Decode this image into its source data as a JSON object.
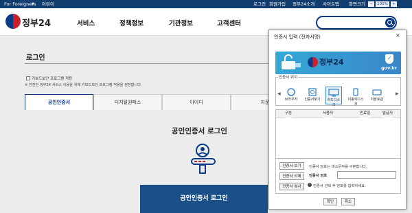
{
  "topbar": {
    "for_foreigners": "For Foreigners",
    "kids": "어린이",
    "login": "로그인",
    "signup": "회원가입",
    "about": "정부24소개",
    "sitemap": "사이트맵",
    "screen_size": "화면크기",
    "zoom_out": "−",
    "zoom_level": "100%",
    "zoom_in": "+"
  },
  "header": {
    "logo": "정부24",
    "nav": [
      "서비스",
      "정책정보",
      "기관정보",
      "고객센터"
    ],
    "search_placeholder": ""
  },
  "login_page": {
    "title": "로그인",
    "keyboard_security_label": "키보드보안 프로그램 적용",
    "keyboard_security_note": "※ 안전한 정부24 서비스 이용을 위해 키보드보안 프로그램 적용을 권장합니다.",
    "tabs": [
      "공인인증서",
      "디지털원패스",
      "아이디",
      "지문"
    ],
    "active_tab": "공인인증서",
    "heading": "공인인증서 로그인",
    "login_button": "공인인증서 로그인"
  },
  "cert_dialog": {
    "title": "인증서 입력 (전자서명)",
    "close": "×",
    "banner_title": "정부24",
    "banner_domain": "gov.kr",
    "location_label": "인증서 위치",
    "locations": [
      "브라우저",
      "인증서찾기",
      "하드디스크",
      "이동식디스크",
      "저장토큰"
    ],
    "selected_location": "하드디스크",
    "columns": [
      "구분",
      "사용자",
      "만료일",
      "발급자"
    ],
    "view_button": "인증서 보기",
    "delete_button": "인증서 삭제",
    "copy_button": "인증서 복사",
    "case_note": "인증서 암호는 대소문자를 구분합니다.",
    "password_label": "인증서 암호",
    "password_value": "",
    "instruction": "인증서 선택 후 암호를 입력하세요.",
    "ok": "확인",
    "cancel": "취소"
  },
  "colors": {
    "topbar": "#123e6f",
    "accent": "#0b3b86",
    "login_button": "#1a4f88",
    "banner": "#35a8d6"
  },
  "icons": [
    "chevron-down-icon",
    "government-logo-icon",
    "search-icon",
    "certificate-icon",
    "browser-icon",
    "search-cert-icon",
    "hard-disk-icon",
    "usb-icon",
    "token-icon",
    "shield-icon",
    "info-icon"
  ]
}
